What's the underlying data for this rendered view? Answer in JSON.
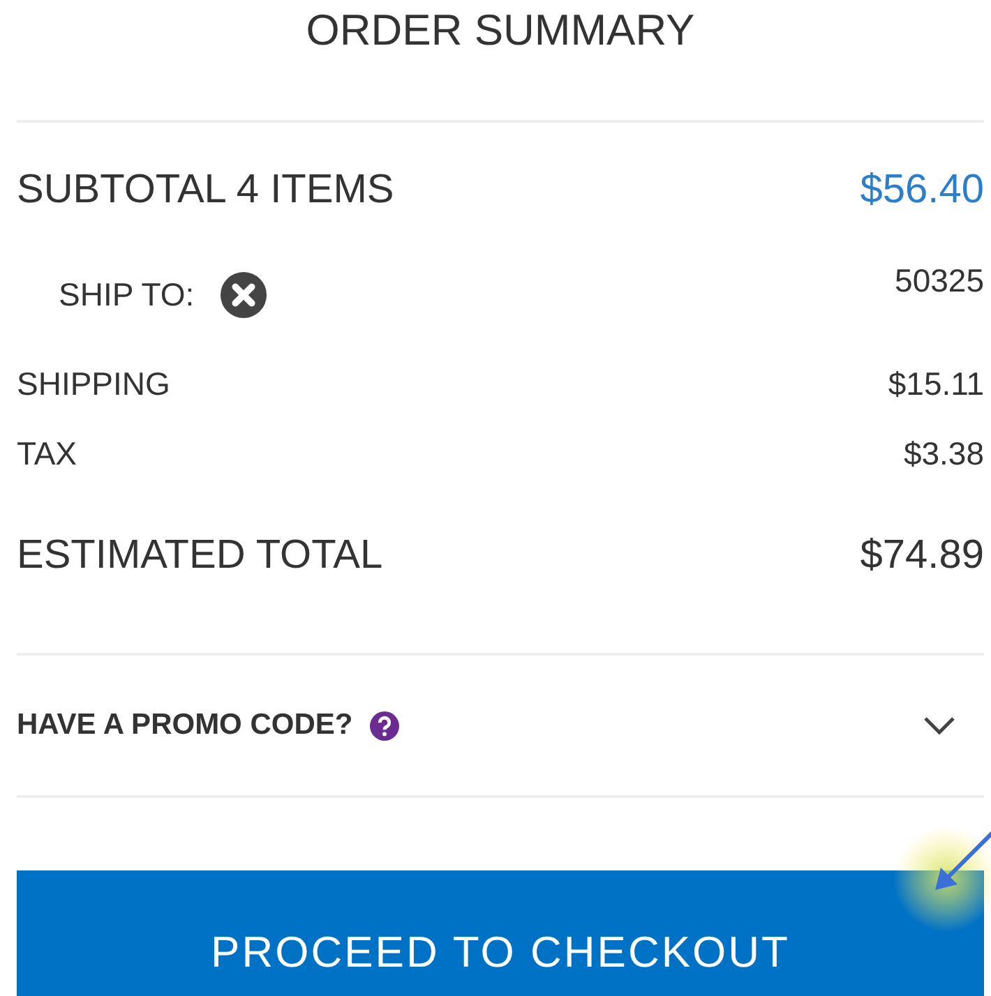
{
  "title": "ORDER SUMMARY",
  "subtotal": {
    "label": "SUBTOTAL 4 ITEMS",
    "value": "$56.40"
  },
  "ship_to": {
    "label": "SHIP TO:",
    "zip": "50325"
  },
  "lines": [
    {
      "label": "SHIPPING",
      "value": "$15.11"
    },
    {
      "label": "TAX",
      "value": "$3.38"
    }
  ],
  "total": {
    "label": "ESTIMATED TOTAL",
    "value": "$74.89"
  },
  "promo": {
    "label": "HAVE A PROMO CODE?",
    "expanded": false
  },
  "checkout_button": "PROCEED TO CHECKOUT"
}
